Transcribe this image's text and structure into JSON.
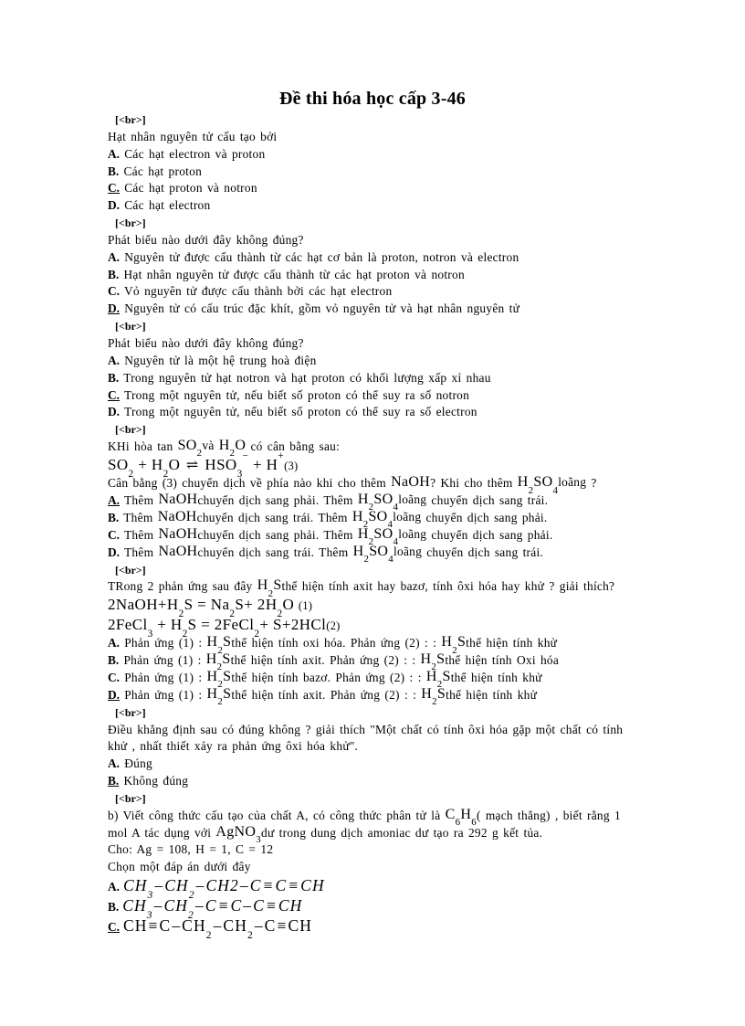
{
  "document": {
    "title": "Đề thi hóa học cấp 3-46",
    "separator": "[<br>]"
  },
  "questions": [
    {
      "id": "q1",
      "stem": "Hạt nhân nguyên  tử cấu tạo bởi",
      "options": [
        {
          "letter": "A.",
          "text": "Các hạt electron  và proton",
          "correct": false
        },
        {
          "letter": "B.",
          "text": "Các hạt proton",
          "correct": false
        },
        {
          "letter": "C.",
          "text": "Các hạt proton và notron",
          "correct": true
        },
        {
          "letter": "D.",
          "text": "Các hạt electron",
          "correct": false
        }
      ]
    },
    {
      "id": "q2",
      "stem": "Phát biểu  nào  dưới đây không  đúng?",
      "options": [
        {
          "letter": "A.",
          "text": "Nguyên  tử được cấu thành  từ các hạt cơ bản là proton,  notron  và electron",
          "correct": false
        },
        {
          "letter": "B.",
          "text": "Hạt nhân  nguyên  tử được cấu thành  từ các hạt proton và notron",
          "correct": false
        },
        {
          "letter": "C.",
          "text": "Vỏ nguyên  tử được cấu thành  bởi các hạt electron",
          "correct": false
        },
        {
          "letter": "D.",
          "text": "Nguyên  tử có cấu trúc  đặc khít,  gồm  vỏ nguyên  tử và hạt nhân  nguyên  tử",
          "correct": true
        }
      ]
    },
    {
      "id": "q3",
      "stem": "Phát biểu  nào dưới đây không  đúng?",
      "options": [
        {
          "letter": "A.",
          "text": "Nguyên  tử là một hệ trung  hoà  điện",
          "correct": false
        },
        {
          "letter": "B.",
          "text": "Trong  nguyên  tử hạt notron  và hạt proton  có khối  lượng  xấp xỉ  nhau",
          "correct": false
        },
        {
          "letter": "C.",
          "text": "Trong  một nguyên  tử, nếu biết số proton  có thể  suy  ra số notron",
          "correct": true
        },
        {
          "letter": "D.",
          "text": "Trong  một nguyên  tử, nếu biết số proton  có thể  suy  ra số electron",
          "correct": false
        }
      ]
    },
    {
      "id": "q4",
      "stem_prefix": "KHi hòa tan ",
      "stem_f1": "SO",
      "stem_f1_sub": "2",
      "stem_mid": "và",
      "stem_f2_h": "H",
      "stem_f2_sub": "2",
      "stem_f2_o": "O",
      "stem_suffix": "có cân bằng sau:",
      "equation": {
        "left_so2": "SO",
        "left_so2_sub": "2",
        "plus1": "+",
        "h2o_h": "H",
        "h2o_sub": "2",
        "h2o_o": "O",
        "arrow": "⇌",
        "hso3": "HSO",
        "hso3_sub": "3",
        "hso3_sup": "−",
        "plus2": "+",
        "hplus": "H",
        "hplus_sup": "+",
        "number": "(3)"
      },
      "ask_part1": "Cân bằng (3) chuyển  dịch về phía nào khi cho thêm ",
      "ask_naoh": "NaOH",
      "ask_part2": "? Khi cho  thêm ",
      "ask_h2so4": "H",
      "ask_h2so4_s2": "2",
      "ask_h2so4_so": "SO",
      "ask_h2so4_s4": "4",
      "ask_loang": "loãng",
      "ask_part3": " ?",
      "options": [
        {
          "letter": "A.",
          "pre": "Thêm ",
          "f1": "NaOH",
          "mid": "chuyển  dịch sang phải. Thêm ",
          "f2_h": "H",
          "f2_s2": "2",
          "f2_so": "SO",
          "f2_s4": "4",
          "f2_tail": "loãng",
          "post": " chuyển  dịch sang trái.",
          "correct": true
        },
        {
          "letter": "B.",
          "pre": "Thêm ",
          "f1": "NaOH",
          "mid": "chuyển  dịch sang trái. Thêm ",
          "f2_h": "H",
          "f2_s2": "2",
          "f2_so": "SO",
          "f2_s4": "4",
          "f2_tail": "loãng",
          "post": " chuyển  dịch sang phải.",
          "correct": false
        },
        {
          "letter": "C.",
          "pre": "Thêm ",
          "f1": "NaOH",
          "mid": "chuyển  dịch sang phải. Thêm ",
          "f2_h": "H",
          "f2_s2": "2",
          "f2_so": "SO",
          "f2_s4": "4",
          "f2_tail": "loãng",
          "post": " chuyển  dịch sang phải.",
          "correct": false
        },
        {
          "letter": "D.",
          "pre": "Thêm ",
          "f1": "NaOH",
          "mid": "chuyển  dịch sang trái. Thêm ",
          "f2_h": "H",
          "f2_s2": "2",
          "f2_so": "SO",
          "f2_s4": "4",
          "f2_tail": "loãng",
          "post": " chuyển  dịch sang trái.",
          "correct": false
        }
      ]
    },
    {
      "id": "q5",
      "stem_pre": "TRong  2 phản ứng sau đây ",
      "stem_h2s_h": "H",
      "stem_h2s_sub": "2",
      "stem_h2s_s": "S",
      "stem_post": "thể hiện  tính  axit  hay  bazơ, tính  ôxi hóa hay khử ? giải thích?",
      "eq1": {
        "naoh": "2NaOH",
        "plus1": "+",
        "h2s_h": "H",
        "h2s_sub": "2",
        "h2s_s": "S",
        "eq": "=",
        "na2s_na": "Na",
        "na2s_sub": "2",
        "na2s_s": "S",
        "plus2": "+",
        "h2o_pre": "2H",
        "h2o_sub": "2",
        "h2o_o": "O",
        "number": "(1)"
      },
      "eq2": {
        "fecl3": "2FeCl",
        "fecl3_sub": "3",
        "plus1": "+",
        "h2s_h": "H",
        "h2s_sub": "2",
        "h2s_s": "S",
        "eq": "=",
        "fecl2": "2FeCl",
        "fecl2_sub": "2",
        "rest": "+ S+2HCl",
        "number": "(2)"
      },
      "options": [
        {
          "letter": "A.",
          "pre": "Phản ứng (1) : ",
          "f1_h": "H",
          "f1_sub": "2",
          "f1_s": "S",
          "mid": "thể hiện  tính  oxi hóa. Phản ứng (2) : : ",
          "f2_h": "H",
          "f2_sub": "2",
          "f2_s": "S",
          "post": "thể hiện  tính  khử",
          "correct": false
        },
        {
          "letter": "B.",
          "pre": "Phản ứng (1) : ",
          "f1_h": "H",
          "f1_sub": "2",
          "f1_s": "S",
          "mid": "thể hiện  tính  axit.  Phản ứng (2) : : ",
          "f2_h": "H",
          "f2_sub": "2",
          "f2_s": "S",
          "post": "thể hiện  tính  Oxi hóa",
          "correct": false
        },
        {
          "letter": "C.",
          "pre": "Phản ứng (1) : ",
          "f1_h": "H",
          "f1_sub": "2",
          "f1_s": "S",
          "mid": "thể hiện  tính  bazơ. Phản ứng (2) : : ",
          "f2_h": "H",
          "f2_sub": "2",
          "f2_s": "S",
          "post": "thể hiện  tính  khử",
          "correct": false
        },
        {
          "letter": "D.",
          "pre": "Phản ứng (1) : ",
          "f1_h": "H",
          "f1_sub": "2",
          "f1_s": "S",
          "mid": "thể hiện  tính  axit.  Phản ứng (2) : : ",
          "f2_h": "H",
          "f2_sub": "2",
          "f2_s": "S",
          "post": "thể hiện  tính  khử",
          "correct": true
        }
      ]
    },
    {
      "id": "q6",
      "stem_line1": "Điều khẳng  định  sau có đúng  không ? giải  thích  \"Một chất có tính  ôxi hóa gặp một chất có tính",
      "stem_line2": "khử , nhất thiết  xảy  ra phản ứng ôxi hóa khử\".",
      "options": [
        {
          "letter": "A.",
          "text": "Đúng",
          "correct": false
        },
        {
          "letter": "B.",
          "text": "Không  đúng",
          "correct": true
        }
      ]
    },
    {
      "id": "q7",
      "stem_line1_pre": "b) Viết  công thức  cấu tạo của chất A, có công thức phân tử là ",
      "stem_c6h6_c": "C",
      "stem_c6h6_s1": "6",
      "stem_c6h6_h": "H",
      "stem_c6h6_s2": "6",
      "stem_line1_post": "( mạch thẳng)  , biết rằng 1",
      "stem_line2_pre": "mol  A tác dụng với ",
      "stem_agno3": "AgNO",
      "stem_agno3_sub": "3",
      "stem_line2_post": "dư trong  dung  dịch  amoniac   dư tạo ra 292 g kết tủa.",
      "given": "Cho:  Ag = 108, H = 1, C = 12",
      "instruction": "Chọn một đáp án dưới đây",
      "options": [
        {
          "letter": "A.",
          "correct": false,
          "italic": true,
          "parts": [
            {
              "t": "CH"
            },
            {
              "sub": "3"
            },
            {
              "t": "–"
            },
            {
              "t": "CH"
            },
            {
              "sub": "2"
            },
            {
              "t": "–"
            },
            {
              "t": "CH2"
            },
            {
              "t": "–"
            },
            {
              "t": "C"
            },
            {
              "t": "≡"
            },
            {
              "t": "C"
            },
            {
              "t": "≡"
            },
            {
              "t": "CH"
            }
          ]
        },
        {
          "letter": "B.",
          "correct": false,
          "italic": true,
          "parts": [
            {
              "t": "CH"
            },
            {
              "sub": "3"
            },
            {
              "t": "–"
            },
            {
              "t": "CH"
            },
            {
              "sub": "2"
            },
            {
              "t": "–"
            },
            {
              "t": "C"
            },
            {
              "t": "≡"
            },
            {
              "t": "C"
            },
            {
              "t": "–"
            },
            {
              "t": "C"
            },
            {
              "t": "≡"
            },
            {
              "t": "CH"
            }
          ]
        },
        {
          "letter": "C.",
          "correct": true,
          "italic": false,
          "parts": [
            {
              "t": "CH"
            },
            {
              "t": "≡"
            },
            {
              "t": "C"
            },
            {
              "t": "–"
            },
            {
              "t": "CH"
            },
            {
              "sub": "2"
            },
            {
              "t": "–"
            },
            {
              "t": "CH"
            },
            {
              "sub": "2"
            },
            {
              "t": "–"
            },
            {
              "t": "C"
            },
            {
              "t": "≡"
            },
            {
              "t": "CH"
            }
          ]
        }
      ]
    }
  ]
}
